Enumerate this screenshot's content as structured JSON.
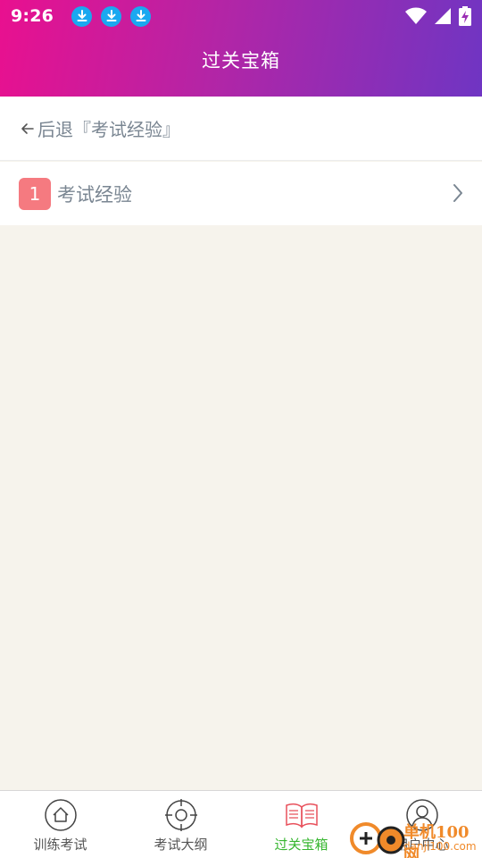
{
  "status_bar": {
    "time": "9:26",
    "download_icons": [
      "download-icon",
      "download-icon",
      "download-icon"
    ],
    "right_icons": [
      "wifi-icon",
      "cell-signal-icon",
      "battery-charging-icon"
    ]
  },
  "header": {
    "title": "过关宝箱"
  },
  "nav": {
    "back_label": "后退『考试经验』"
  },
  "list": {
    "items": [
      {
        "number": "1",
        "label": "考试经验"
      }
    ]
  },
  "tabbar": {
    "tabs": [
      {
        "label": "训练考试",
        "icon": "home-icon",
        "active": false
      },
      {
        "label": "考试大纲",
        "icon": "target-icon",
        "active": false
      },
      {
        "label": "过关宝箱",
        "icon": "book-icon",
        "active": true
      },
      {
        "label": "用户中心",
        "icon": "user-icon",
        "active": false
      }
    ]
  },
  "watermark": {
    "line1": "单机100网",
    "line2": "danji100.com"
  },
  "colors": {
    "header_start": "#e9108f",
    "header_end": "#6f35c3",
    "active_tab": "#36b62f",
    "badge": "#f57a80",
    "download_badge": "#1aa8f0"
  }
}
